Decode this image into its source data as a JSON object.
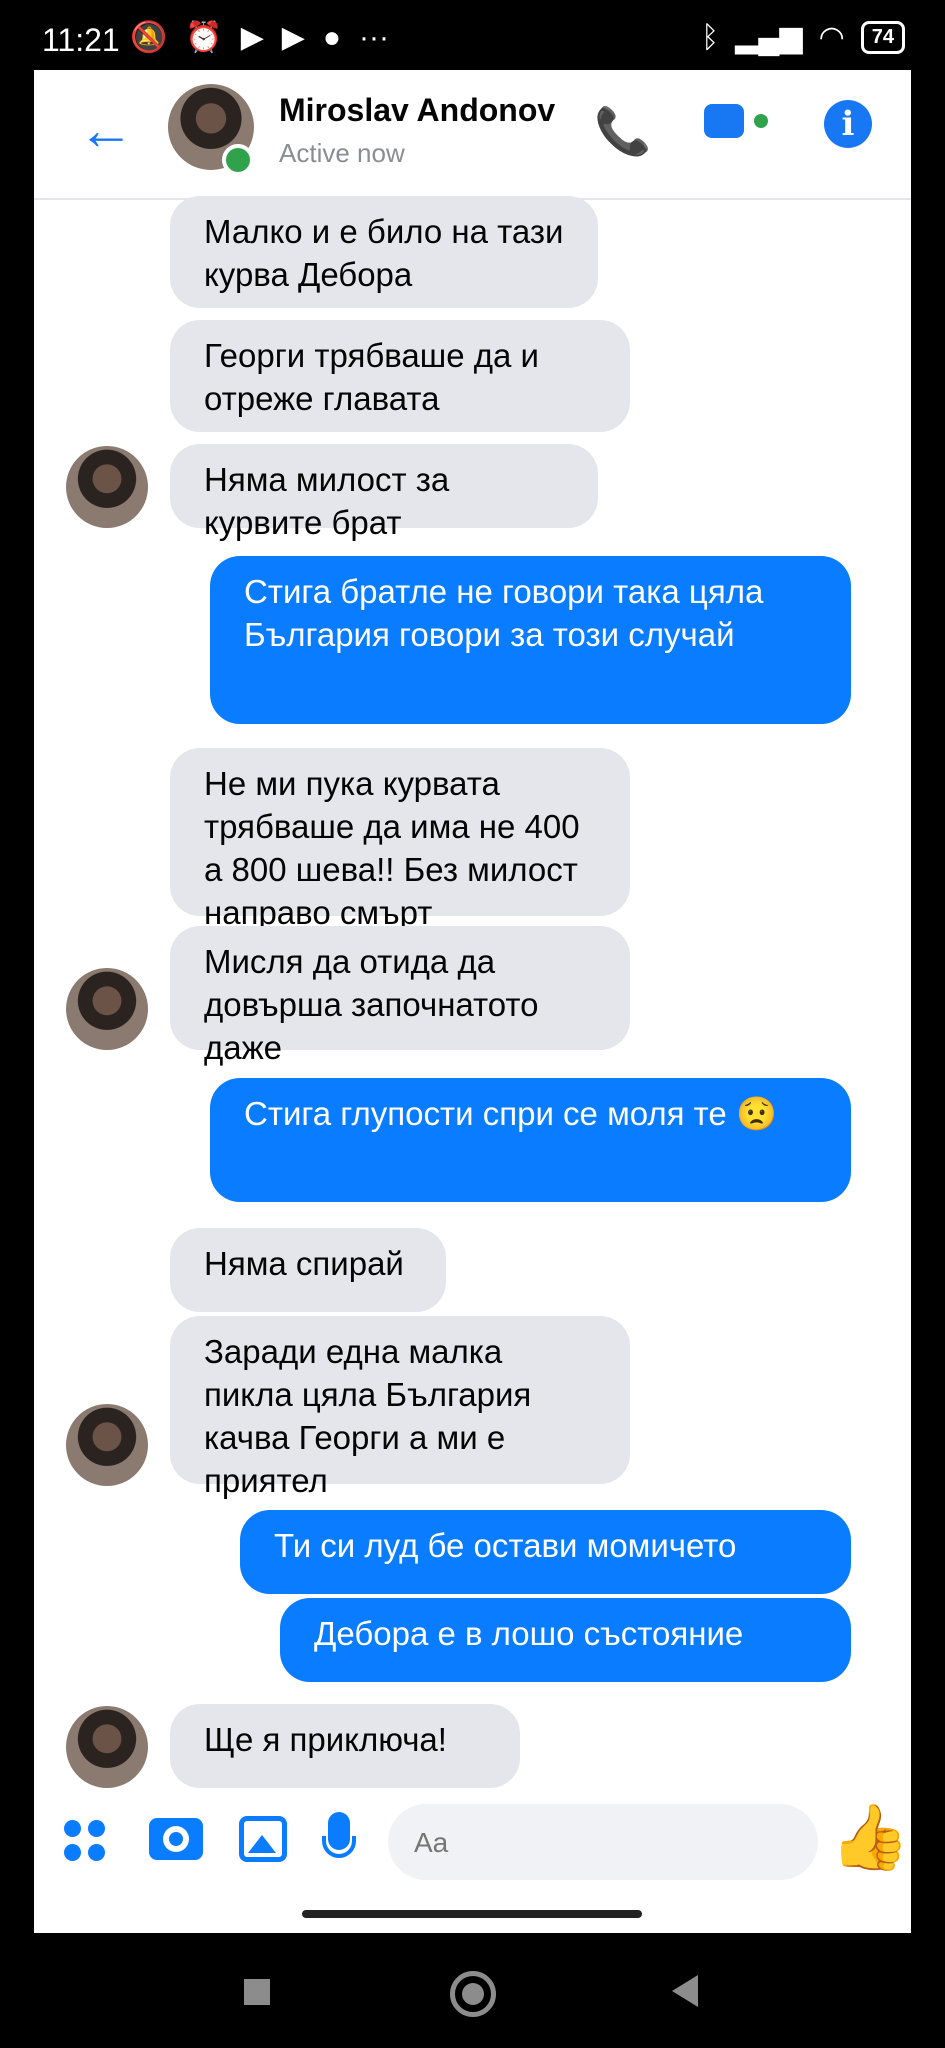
{
  "statusbar": {
    "time": "11:21",
    "battery": "74"
  },
  "header": {
    "contact_name": "Miroslav Andonov",
    "status": "Active now"
  },
  "messages": [
    {
      "side": "in",
      "text": "Малко и е било на тази курва Дебора"
    },
    {
      "side": "in",
      "text": "Георги трябваше да и отреже главата"
    },
    {
      "side": "in",
      "text": "Няма милост за курвите брат"
    },
    {
      "side": "out",
      "text": "Стига братле не говори така цяла България говори за този случай"
    },
    {
      "side": "in",
      "text": "Не ми пука курвата трябваше да има не 400 а 800 шева!! Без милост направо смърт"
    },
    {
      "side": "in",
      "text": "Мисля да отида да довърша започнатото даже"
    },
    {
      "side": "out",
      "text": "Стига глупости спри се моля те 😟"
    },
    {
      "side": "in",
      "text": "Няма спирай"
    },
    {
      "side": "in",
      "text": "Заради една малка пикла цяла България качва Георги а ми е приятел"
    },
    {
      "side": "out",
      "text": "Ти си луд бе остави момичето"
    },
    {
      "side": "out",
      "text": "Дебора е в лошо състояние"
    },
    {
      "side": "in",
      "text": "Ще я приключа!"
    }
  ],
  "composer": {
    "placeholder": "Aa"
  },
  "icons": {
    "back": "arrow-left-icon",
    "phone": "phone-icon",
    "video": "video-camera-icon",
    "info": "info-icon",
    "apps": "apps-grid-icon",
    "camera": "camera-icon",
    "gallery": "gallery-icon",
    "mic": "microphone-icon",
    "emoji": "emoji-icon",
    "like": "thumbs-up-icon"
  },
  "colors": {
    "accent": "#0a7cff",
    "incoming_bubble": "#e4e6eb",
    "online": "#31a24c"
  }
}
